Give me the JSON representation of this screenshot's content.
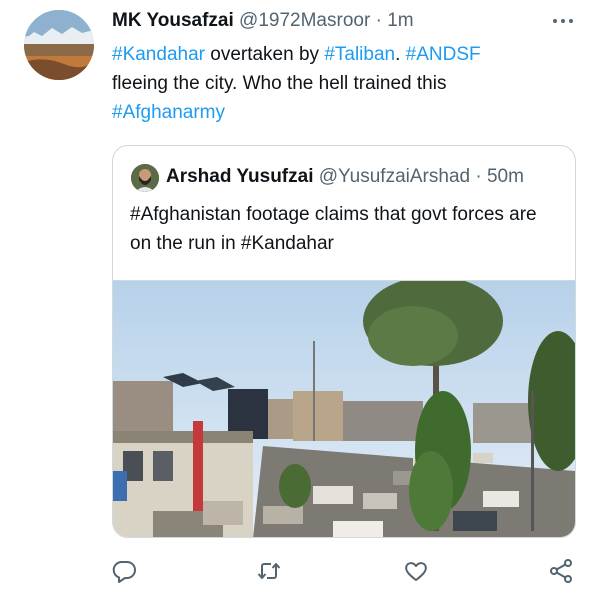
{
  "tweet": {
    "author_name": "MK Yousafzai",
    "author_handle": "@1972Masroor",
    "separator": " · ",
    "time": "1m",
    "text_parts": [
      {
        "text": "#Kandahar",
        "hashtag": true
      },
      {
        "text": " overtaken by ",
        "hashtag": false
      },
      {
        "text": "#Taliban",
        "hashtag": true
      },
      {
        "text": ". ",
        "hashtag": false
      },
      {
        "text": "#ANDSF",
        "hashtag": true
      },
      {
        "text": " fleeing the city. Who the hell trained this ",
        "hashtag": false
      },
      {
        "text": "#Afghanarmy",
        "hashtag": true
      }
    ]
  },
  "quoted_tweet": {
    "author_name": "Arshad Yusufzai",
    "author_handle": "@YusufzaiArshad",
    "separator": " · ",
    "time": "50m",
    "text": "#Afghanistan footage claims that govt forces are on the run in #Kandahar"
  },
  "actions": {
    "icons": [
      "reply-icon",
      "retweet-icon",
      "like-icon",
      "share-icon"
    ]
  },
  "colors": {
    "hashtag": "#1d9bf0",
    "secondary_text": "#536471",
    "icon": "#536471",
    "border": "#cfd9de"
  }
}
